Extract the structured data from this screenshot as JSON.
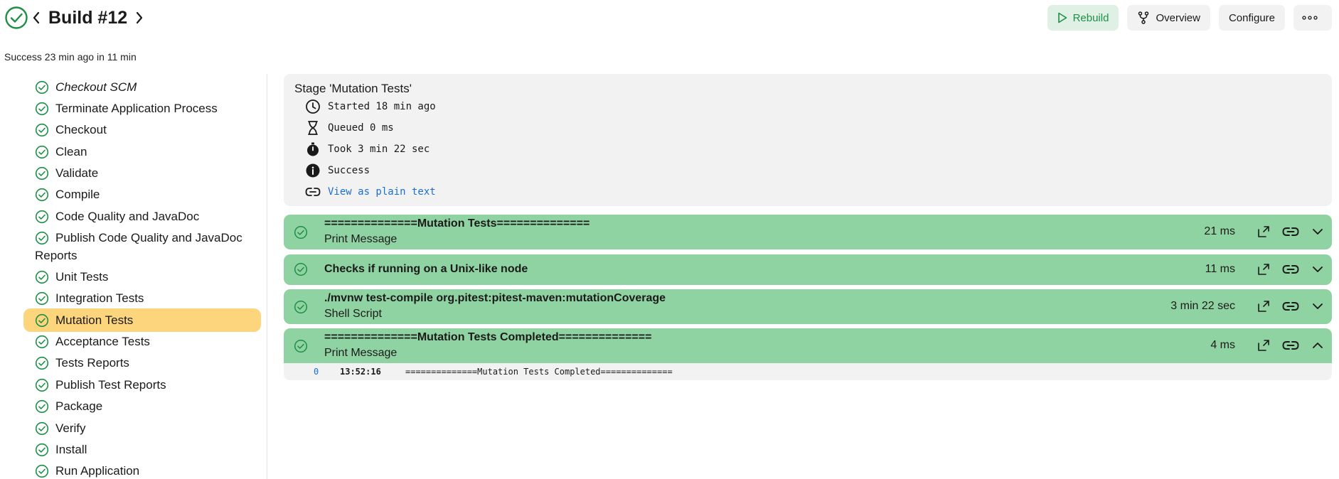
{
  "header": {
    "title": "Build #12",
    "subtitle": "Success 23 min ago in 11 min",
    "actions": {
      "rebuild": "Rebuild",
      "overview": "Overview",
      "configure": "Configure"
    }
  },
  "sidebar": {
    "stages": [
      "Checkout SCM",
      "Terminate Application Process",
      "Checkout",
      "Clean",
      "Validate",
      "Compile",
      "Code Quality and JavaDoc",
      "Publish Code Quality and JavaDoc Reports",
      "Unit Tests",
      "Integration Tests",
      "Mutation Tests",
      "Acceptance Tests",
      "Tests Reports",
      "Publish Test Reports",
      "Package",
      "Verify",
      "Install",
      "Run Application"
    ],
    "selected": "Mutation Tests"
  },
  "stage_info": {
    "title": "Stage 'Mutation Tests'",
    "started": "Started 18 min ago",
    "queued": "Queued 0 ms",
    "took": "Took 3 min 22 sec",
    "status": "Success",
    "plain_text_link": "View as plain text"
  },
  "steps": [
    {
      "title": "==============Mutation Tests==============",
      "subtitle": "Print Message",
      "duration": "21 ms",
      "expanded": false
    },
    {
      "title": "Checks if running on a Unix-like node",
      "subtitle": "",
      "duration": "11 ms",
      "expanded": false
    },
    {
      "title": "./mvnw test-compile org.pitest:pitest-maven:mutationCoverage",
      "subtitle": "Shell Script",
      "duration": "3 min 22 sec",
      "expanded": false
    },
    {
      "title": "==============Mutation Tests Completed==============",
      "subtitle": "Print Message",
      "duration": "4 ms",
      "expanded": true
    }
  ],
  "log": {
    "line_number": "0",
    "timestamp": "13:52:16",
    "message": "==============Mutation Tests Completed=============="
  },
  "colors": {
    "success_green": "#1e8f45",
    "step_bg": "#90d3a2",
    "selected_bg": "#fdd57d",
    "panel_bg": "#f2f2f2",
    "link_blue": "#1a6fd6"
  }
}
